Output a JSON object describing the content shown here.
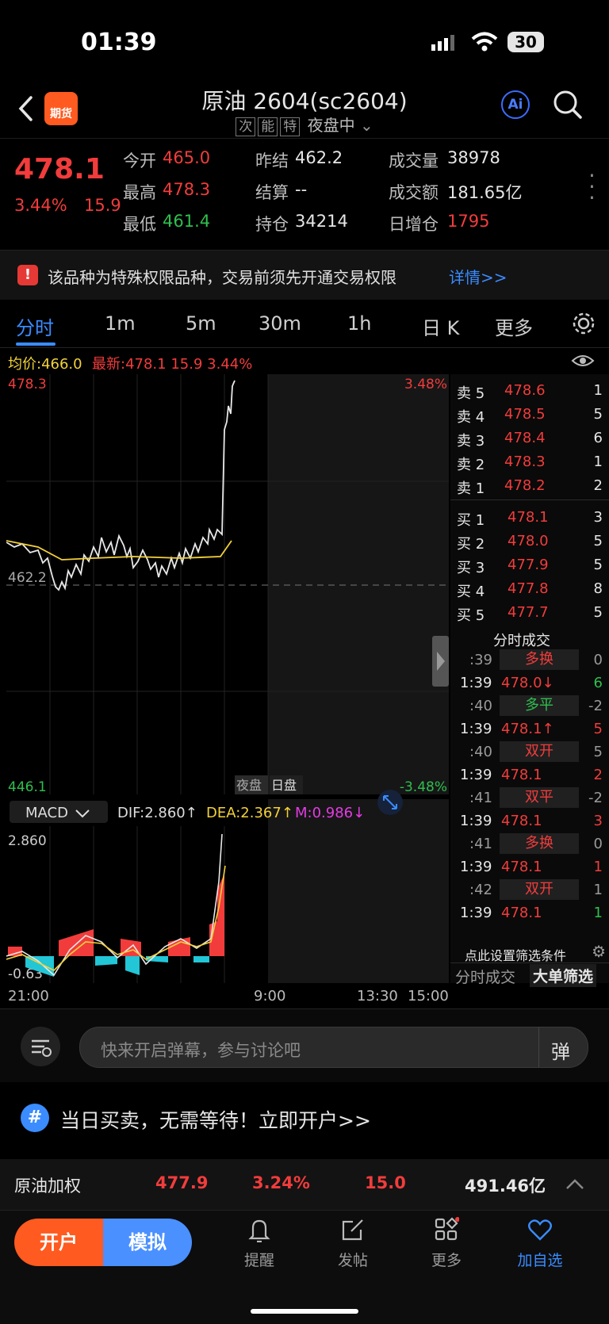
{
  "status": {
    "time": "01:39",
    "battery": "30"
  },
  "header": {
    "badge": "期货",
    "title": "原油 2604(sc2604)",
    "tags": [
      "次",
      "能",
      "特"
    ],
    "session": "夜盘中",
    "ai": "Ai"
  },
  "quote": {
    "last": "478.1",
    "pct": "3.44%",
    "chg": "15.9",
    "fields": [
      {
        "label": "今开",
        "value": "465.0",
        "tone": "red"
      },
      {
        "label": "昨结",
        "value": "462.2",
        "tone": "white"
      },
      {
        "label": "成交量",
        "value": "38978",
        "tone": "white"
      },
      {
        "label": "最高",
        "value": "478.3",
        "tone": "red"
      },
      {
        "label": "结算",
        "value": "--",
        "tone": "white"
      },
      {
        "label": "成交额",
        "value": "181.65亿",
        "tone": "white"
      },
      {
        "label": "最低",
        "value": "461.4",
        "tone": "green"
      },
      {
        "label": "持仓",
        "value": "34214",
        "tone": "white"
      },
      {
        "label": "日增仓",
        "value": "1795",
        "tone": "red"
      }
    ]
  },
  "notice": {
    "text": "该品种为特殊权限品种，交易前须先开通交易权限",
    "link": "详情>>"
  },
  "tabs": [
    "分时",
    "1m",
    "5m",
    "30m",
    "1h",
    "日 K",
    "更多"
  ],
  "avgbar": {
    "avg_label": "均价:",
    "avg": "466.0",
    "latest_label": "最新:",
    "latest": "478.1",
    "chg": "15.9",
    "pct": "3.44%"
  },
  "chart": {
    "y_top": "478.3",
    "y_mid": "462.2",
    "y_bot": "446.1",
    "pct_top": "3.48%",
    "pct_bot": "-3.48%",
    "session_night": "夜盘",
    "session_day": "日盘",
    "macd_label": "MACD",
    "dif": "DIF:2.860↑",
    "dea": "DEA:2.367↑",
    "m": "M:0.986↓",
    "macd_top": "2.860",
    "macd_bot": "-0.63",
    "x_labels": [
      "21:00",
      "9:00",
      "13:30",
      "15:00"
    ]
  },
  "book": {
    "asks": [
      {
        "label": "卖 5",
        "price": "478.6",
        "qty": "1"
      },
      {
        "label": "卖 4",
        "price": "478.5",
        "qty": "5"
      },
      {
        "label": "卖 3",
        "price": "478.4",
        "qty": "6"
      },
      {
        "label": "卖 2",
        "price": "478.3",
        "qty": "1"
      },
      {
        "label": "卖 1",
        "price": "478.2",
        "qty": "2"
      }
    ],
    "bids": [
      {
        "label": "买 1",
        "price": "478.1",
        "qty": "3"
      },
      {
        "label": "买 2",
        "price": "478.0",
        "qty": "5"
      },
      {
        "label": "买 3",
        "price": "477.9",
        "qty": "5"
      },
      {
        "label": "买 4",
        "price": "477.8",
        "qty": "8"
      },
      {
        "label": "买 5",
        "price": "477.7",
        "qty": "5"
      }
    ],
    "trades_title": "分时成交",
    "trades": [
      {
        "time": ":39",
        "tag": "多换",
        "tag_tone": "red",
        "qty": "0",
        "qty_tone": "gray"
      },
      {
        "time": "1:39",
        "price": "478.0↓",
        "qty": "6",
        "qty_tone": "green"
      },
      {
        "time": ":40",
        "tag": "多平",
        "tag_tone": "green",
        "qty": "-2",
        "qty_tone": "gray"
      },
      {
        "time": "1:39",
        "price": "478.1↑",
        "qty": "5",
        "qty_tone": "red"
      },
      {
        "time": ":40",
        "tag": "双开",
        "tag_tone": "red",
        "qty": "5",
        "qty_tone": "gray"
      },
      {
        "time": "1:39",
        "price": "478.1",
        "qty": "2",
        "qty_tone": "red"
      },
      {
        "time": ":41",
        "tag": "双平",
        "tag_tone": "red",
        "qty": "-2",
        "qty_tone": "gray"
      },
      {
        "time": "1:39",
        "price": "478.1",
        "qty": "3",
        "qty_tone": "red"
      },
      {
        "time": ":41",
        "tag": "多换",
        "tag_tone": "red",
        "qty": "0",
        "qty_tone": "gray"
      },
      {
        "time": "1:39",
        "price": "478.1",
        "qty": "1",
        "qty_tone": "red"
      },
      {
        "time": ":42",
        "tag": "双开",
        "tag_tone": "red",
        "qty": "1",
        "qty_tone": "gray"
      },
      {
        "time": "1:39",
        "price": "478.1",
        "qty": "1",
        "qty_tone": "green"
      }
    ],
    "filter_hint": "点此设置筛选条件",
    "tab_trades": "分时成交",
    "tab_big": "大单筛选"
  },
  "danmu": {
    "placeholder": "快来开启弹幕，参与讨论吧",
    "button": "弹"
  },
  "promo": {
    "text": "当日买卖，无需等待！立即开户>>"
  },
  "bottomquote": {
    "name": "原油加权",
    "price": "477.9",
    "pct": "3.24%",
    "chg": "15.0",
    "amount": "491.46亿"
  },
  "nav": {
    "open": "开户",
    "sim": "模拟",
    "items": [
      "提醒",
      "发帖",
      "更多",
      "加自选"
    ]
  },
  "colors": {
    "red": "#f23c3c",
    "green": "#2fbf4e",
    "yellow": "#f2d13a",
    "blue": "#3a8cff",
    "accent": "#ff5a1f"
  },
  "icons": [
    "back-icon",
    "ai-icon",
    "search-icon",
    "more-dots-icon",
    "warning-icon",
    "gear-icon",
    "eye-icon",
    "expand-icon",
    "bell-icon",
    "edit-icon",
    "apps-icon",
    "heart-icon",
    "chevron-up-icon"
  ]
}
